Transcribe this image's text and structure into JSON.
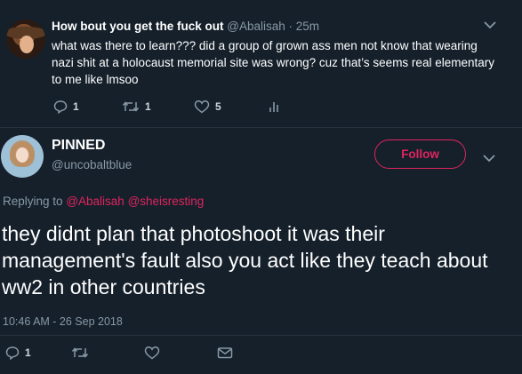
{
  "parent_tweet": {
    "display_name": "How bout you get the fuck out",
    "handle": "@Abalisah",
    "separator": " · ",
    "time": "25m",
    "text": "what was there to learn??? did a group of grown ass men not know that wearing nazi shit at a holocaust memorial site was wrong? cuz that’s seems real elementary to me like lmsoo",
    "reply_count": "1",
    "retweet_count": "1",
    "like_count": "5"
  },
  "main_tweet": {
    "display_name": "PINNED",
    "handle": "@uncobaltblue",
    "follow_label": "Follow",
    "replying_to_label": "Replying to",
    "mentions": [
      "@Abalisah",
      "@sheisresting"
    ],
    "text": "they didnt plan that photoshoot it was their management's fault also you act like they teach about ww2 in other countries",
    "timestamp": "10:46 AM - 26 Sep 2018",
    "reply_count": "1"
  },
  "colors": {
    "background": "#15202b",
    "secondary_text": "#8899a6",
    "accent": "#e0245e"
  }
}
